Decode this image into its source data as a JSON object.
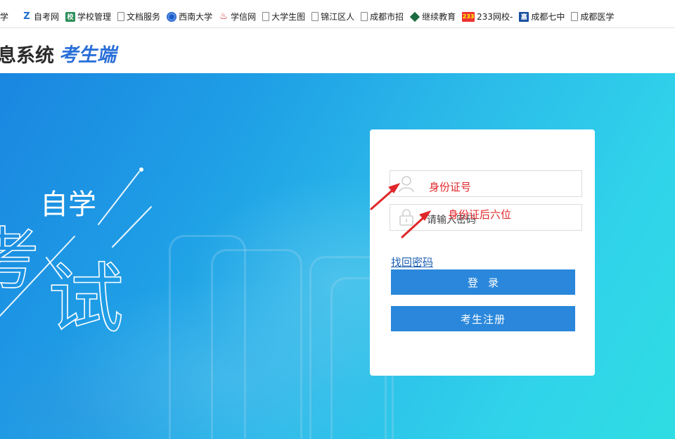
{
  "bookmarks": [
    {
      "label": "学",
      "icon": "page-icon"
    },
    {
      "label": "自考网",
      "icon": "z-logo-icon"
    },
    {
      "label": "学校管理",
      "icon": "school-icon"
    },
    {
      "label": "文档服务",
      "icon": "page-icon"
    },
    {
      "label": "西南大学",
      "icon": "globe-icon"
    },
    {
      "label": "学信网",
      "icon": "flame-icon"
    },
    {
      "label": "大学生图",
      "icon": "page-icon"
    },
    {
      "label": "锦江区人",
      "icon": "page-icon"
    },
    {
      "label": "成都市招",
      "icon": "page-icon"
    },
    {
      "label": "继续教育",
      "icon": "diamond-icon"
    },
    {
      "label": "233网校-",
      "icon": "num-233-icon",
      "icon_text": "233"
    },
    {
      "label": "成都七中",
      "icon": "jia-icon",
      "icon_text": "嘉"
    },
    {
      "label": "成都医学",
      "icon": "page-icon"
    }
  ],
  "header": {
    "system_title": "息系统",
    "system_subtitle": "考生端"
  },
  "hero": {
    "slogan_small": "自学",
    "slogan_big_1": "考",
    "slogan_big_2": "试"
  },
  "login": {
    "id_field": {
      "value": "",
      "icon": "user-icon"
    },
    "password_field": {
      "value": "请输入密码",
      "icon": "lock-icon"
    },
    "forgot_label": "找回密码",
    "login_label": "登录",
    "register_label": "考生注册"
  },
  "annotations": {
    "id_hint": "身份证号",
    "password_hint": "身份证后六位",
    "color": "#e0262a"
  },
  "colors": {
    "accent": "#2a87db",
    "brand_blue": "#2a6fd8"
  }
}
